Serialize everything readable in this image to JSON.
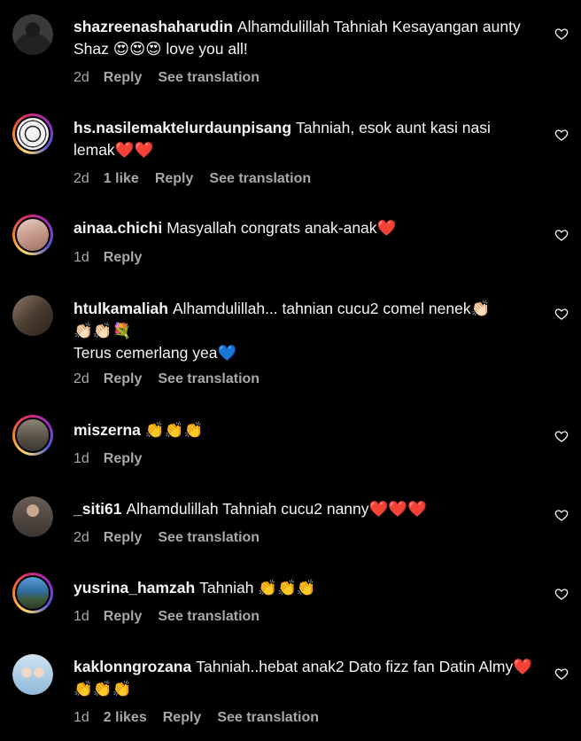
{
  "comments": [
    {
      "username": "shazreenashaharudin",
      "text": "Alhamdulillah Tahniah Kesayangan aunty Shaz 😍😍😍 love you all!",
      "time": "2d",
      "likes": "",
      "reply": "Reply",
      "translate": "See translation",
      "avatar_color": "#3a3a3a",
      "story_ring": false
    },
    {
      "username": "hs.nasilemaktelurdaunpisang",
      "text": "Tahniah, esok aunt kasi nasi lemak❤️❤️",
      "time": "2d",
      "likes": "1 like",
      "reply": "Reply",
      "translate": "See translation",
      "avatar_color": "#f2f2f2",
      "story_ring": true
    },
    {
      "username": "ainaa.chichi",
      "text": "Masyallah congrats anak-anak❤️",
      "time": "1d",
      "likes": "",
      "reply": "Reply",
      "translate": "",
      "avatar_color": "#d9b7a8",
      "story_ring": true
    },
    {
      "username": "htulkamaliah",
      "text": "Alhamdulillah... tahnian cucu2 comel nenek👏🏻\n👏🏻👏🏻💐\nTerus cemerlang yea💙",
      "time": "2d",
      "likes": "",
      "reply": "Reply",
      "translate": "See translation",
      "avatar_color": "#5a4a3a",
      "story_ring": false
    },
    {
      "username": "miszerna",
      "text": "👏👏👏",
      "time": "1d",
      "likes": "",
      "reply": "Reply",
      "translate": "",
      "avatar_color": "#6b6458",
      "story_ring": true
    },
    {
      "username": "_siti61",
      "text": "Alhamdulillah Tahniah cucu2 nanny❤️❤️❤️",
      "time": "2d",
      "likes": "",
      "reply": "Reply",
      "translate": "See translation",
      "avatar_color": "#4a4440",
      "story_ring": false
    },
    {
      "username": "yusrina_hamzah",
      "text": "Tahniah 👏👏👏",
      "time": "1d",
      "likes": "",
      "reply": "Reply",
      "translate": "See translation",
      "avatar_color": "#3b6fa0",
      "story_ring": true
    },
    {
      "username": "kaklonngrozana",
      "text": "Tahniah..hebat anak2 Dato fizz fan Datin Almy❤️👏👏👏",
      "time": "1d",
      "likes": "2 likes",
      "reply": "Reply",
      "translate": "See translation",
      "avatar_color": "#9fc4df",
      "story_ring": false
    }
  ],
  "colors": {
    "background": "#000000",
    "text": "#f5f5f5",
    "meta": "#a8a8a8"
  },
  "icons": {
    "like": "heart-outline-icon"
  }
}
